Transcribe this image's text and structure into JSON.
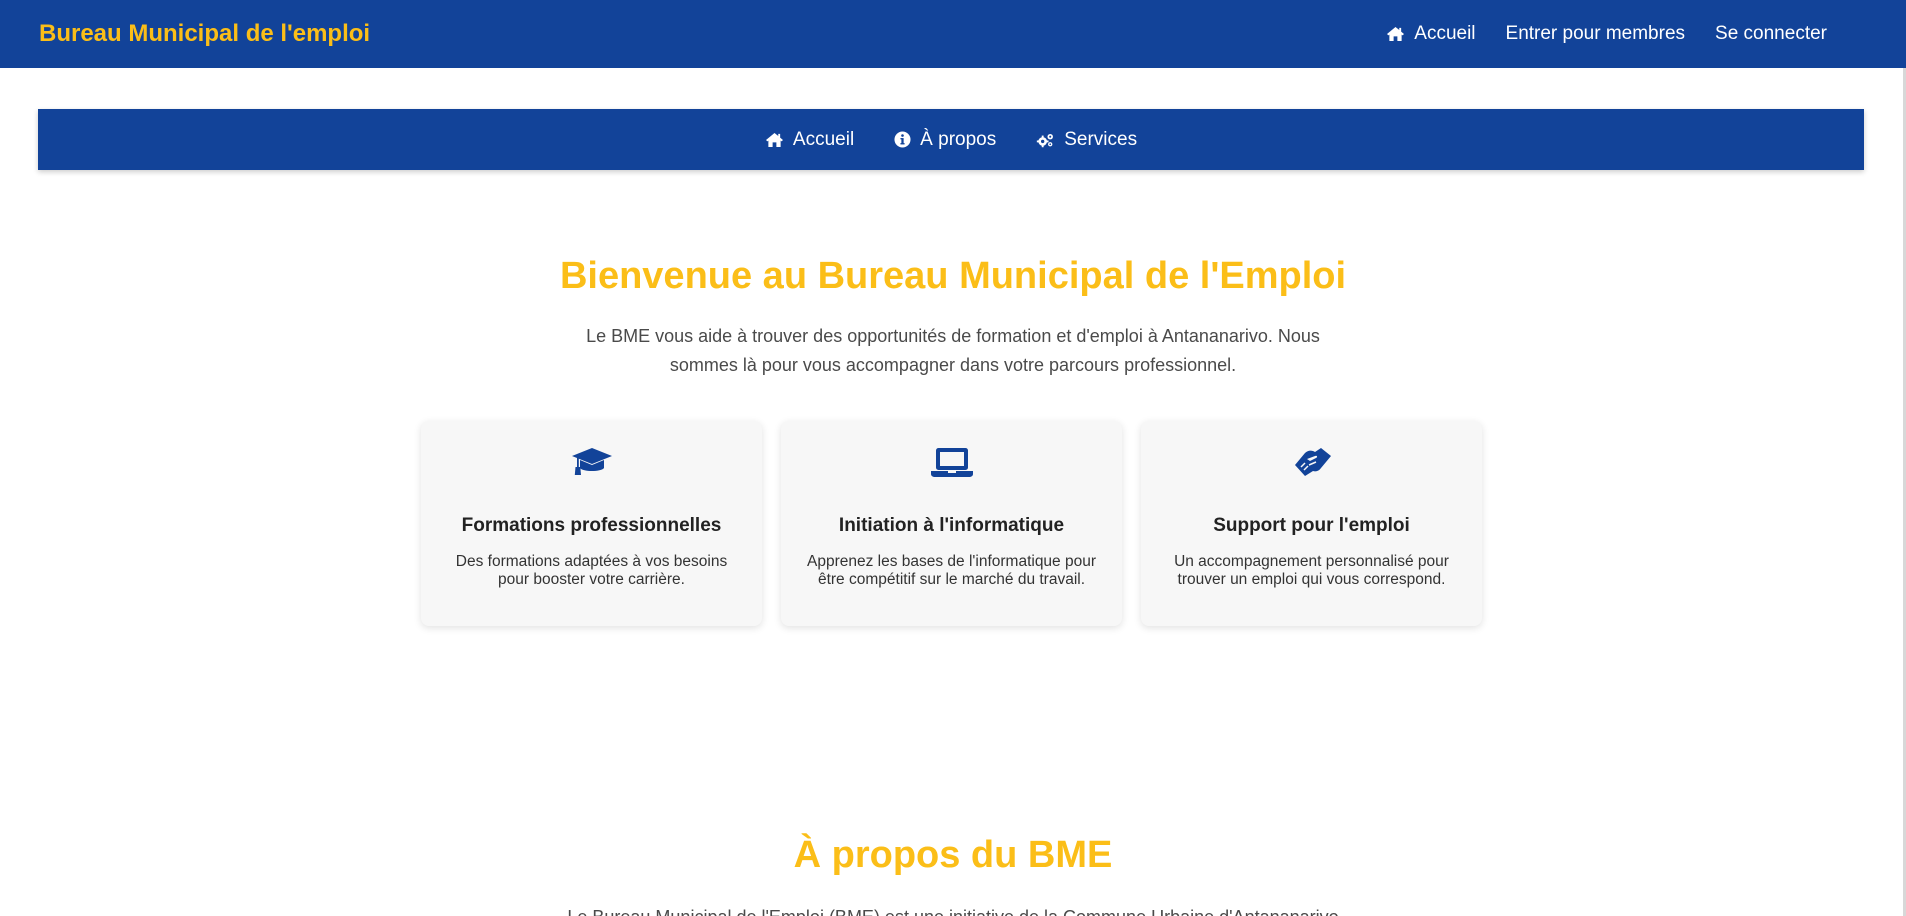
{
  "topbar": {
    "brand": "Bureau Municipal de l'emploi",
    "links": [
      {
        "label": "Accueil",
        "icon": "home-icon"
      },
      {
        "label": "Entrer pour membres"
      },
      {
        "label": "Se connecter"
      }
    ]
  },
  "subnav": {
    "items": [
      {
        "label": "Accueil",
        "icon": "home-icon"
      },
      {
        "label": "À propos",
        "icon": "info-circle-icon"
      },
      {
        "label": "Services",
        "icon": "cogs-icon"
      }
    ]
  },
  "hero": {
    "title": "Bienvenue au Bureau Municipal de l'Emploi",
    "text": "Le BME vous aide à trouver des opportunités de formation et d'emploi à Antananarivo. Nous sommes là pour vous accompagner dans votre parcours professionnel."
  },
  "cards": [
    {
      "icon": "graduation-cap-icon",
      "title": "Formations professionnelles",
      "text": "Des formations adaptées à vos besoins pour booster votre carrière."
    },
    {
      "icon": "laptop-icon",
      "title": "Initiation à l'informatique",
      "text": "Apprenez les bases de l'informatique pour être compétitif sur le marché du travail."
    },
    {
      "icon": "handshake-icon",
      "title": "Support pour l'emploi",
      "text": "Un accompagnement personnalisé pour trouver un emploi qui vous correspond."
    }
  ],
  "about": {
    "title": "À propos du BME",
    "text": "Le Bureau Municipal de l'Emploi (BME) est une initiative de la Commune Urbaine d'Antananarivo"
  },
  "colors": {
    "primary": "#124399",
    "accent": "#fbbe18",
    "card_bg": "#f7f7f7"
  }
}
